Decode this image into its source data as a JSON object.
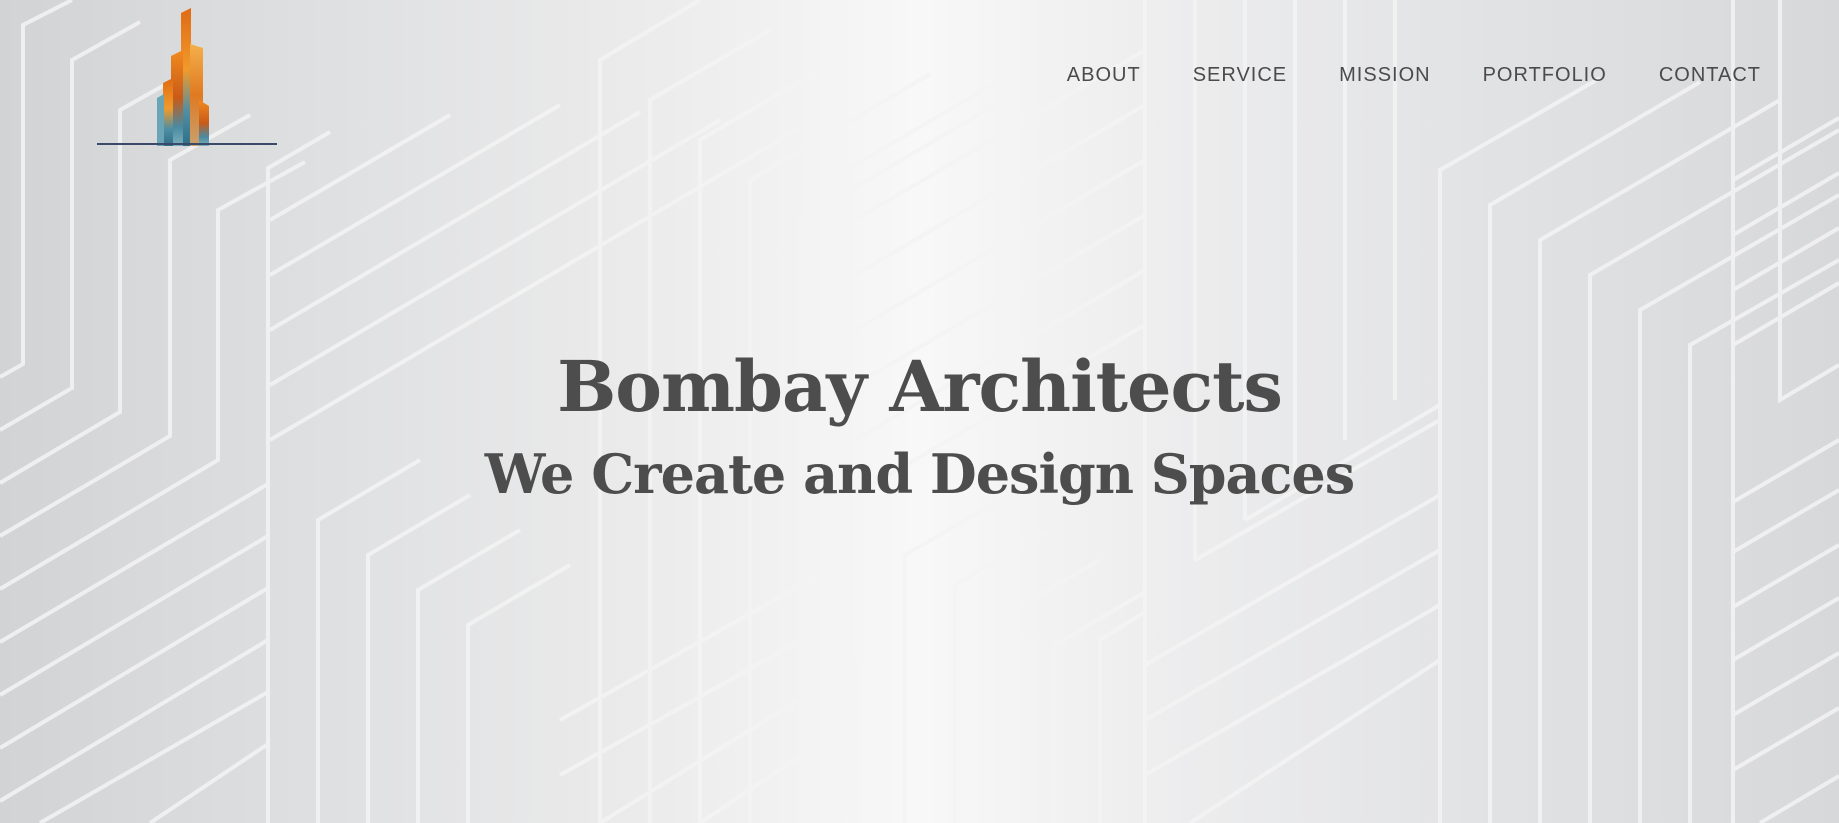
{
  "brand": {
    "logo_icon": "skyscraper-logo",
    "accent_orange": "#e8751a",
    "accent_teal": "#3d8fa3",
    "underline_color": "#3b4a6b"
  },
  "nav": {
    "items": [
      {
        "label": "ABOUT"
      },
      {
        "label": "SERVICE"
      },
      {
        "label": "MISSION"
      },
      {
        "label": "PORTFOLIO"
      },
      {
        "label": "CONTACT"
      }
    ]
  },
  "hero": {
    "title": "Bombay Architects",
    "subtitle": "We Create and Design Spaces"
  },
  "colors": {
    "text": "#4d4d4d",
    "background_light": "#f8f8f8",
    "background_dark": "#d2d3d5",
    "pattern_line": "#f2f2f2"
  }
}
